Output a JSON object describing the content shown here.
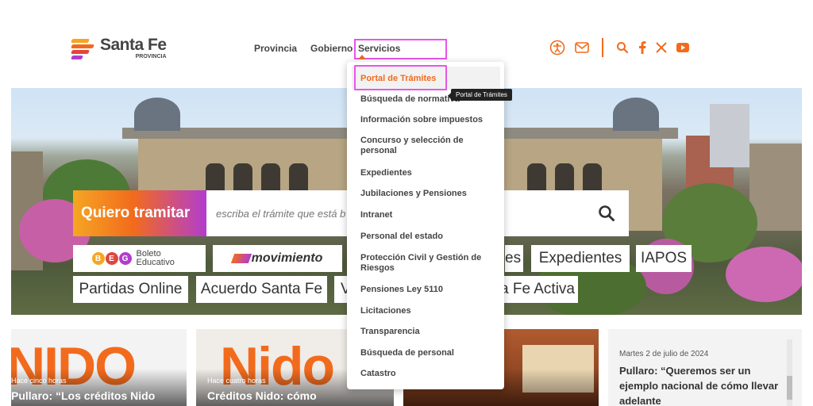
{
  "brand": {
    "name": "Santa Fe",
    "sub": "PROVINCIA"
  },
  "nav": {
    "items": [
      "Provincia",
      "Gobierno"
    ],
    "active": "Servicios"
  },
  "header_icons": [
    "accessibility-icon",
    "mail-icon",
    "search-icon",
    "facebook-icon",
    "x-icon",
    "youtube-icon"
  ],
  "colors": {
    "accent": "#f26b1d",
    "highlight": "#e855e8"
  },
  "hero": {
    "search_label": "Quiero tramitar",
    "search_placeholder": "escriba el trámite que está b",
    "chips_row1": {
      "boleto": "Boleto Educativo",
      "movimiento": "movimiento",
      "es_partial": "es",
      "expedientes": "Expedientes",
      "iapos": "IAPOS"
    },
    "chips_row2": {
      "partidas": "Partidas Online",
      "acuerdo": "Acuerdo Santa Fe",
      "v_partial": "V",
      "activa_partial": "a Fe Activa"
    }
  },
  "dropdown": {
    "items": [
      "Portal de Trámites",
      "Búsqueda de normativa",
      "Información sobre impuestos",
      "Concurso y selección de personal",
      "Expedientes",
      "Jubilaciones y Pensiones",
      "Intranet",
      "Personal del estado",
      "Protección Civil y Gestión de Riesgos",
      "Pensiones Ley 5110",
      "Licitaciones",
      "Transparencia",
      "Búsqueda de personal",
      "Catastro"
    ],
    "tooltip": "Portal de Trámites"
  },
  "cards": [
    {
      "time": "Hace cinco horas",
      "title": "Pullaro: “Los créditos Nido",
      "bg_text": "NIDO"
    },
    {
      "time": "Hace cuatro horas",
      "title": "Créditos Nido: cómo",
      "bg_text": "Nido"
    }
  ],
  "news": {
    "date": "Martes 2 de julio de 2024",
    "title": "Pullaro: “Queremos ser un ejemplo nacional de cómo llevar adelante"
  }
}
